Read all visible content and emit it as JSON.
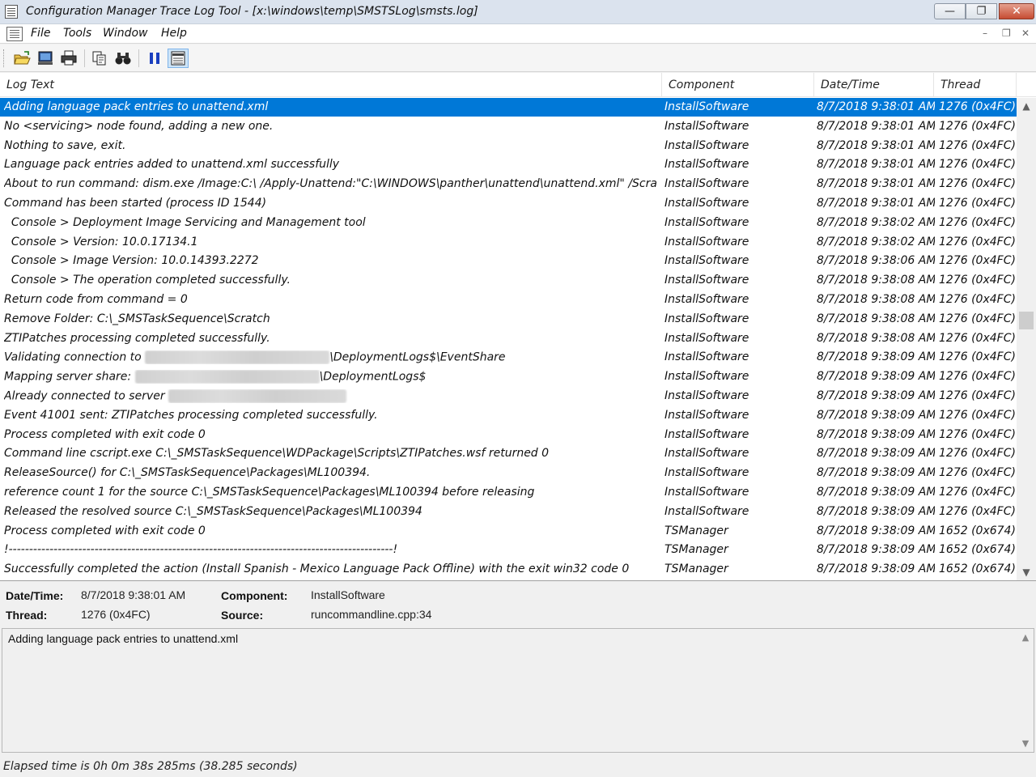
{
  "window": {
    "title": "Configuration Manager Trace Log Tool - [x:\\windows\\temp\\SMSTSLog\\smsts.log]",
    "minimize": "—",
    "maximize": "❐",
    "close": "✕"
  },
  "menu": {
    "items": [
      "File",
      "Tools",
      "Window",
      "Help"
    ],
    "mdi_min": "–",
    "mdi_restore": "❐",
    "mdi_close": "✕"
  },
  "toolbar": {
    "buttons": [
      "open-icon",
      "open-network-icon",
      "print-icon",
      "copy-icon",
      "find-icon",
      "pause-icon",
      "highlight-icon"
    ]
  },
  "columns": {
    "log_text": "Log Text",
    "component": "Component",
    "datetime": "Date/Time",
    "thread": "Thread"
  },
  "rows": [
    {
      "text": "Adding language pack entries to unattend.xml",
      "component": "InstallSoftware",
      "date": "8/7/2018 9:38:01 AM",
      "thread": "1276 (0x4FC)",
      "selected": true
    },
    {
      "text": "No <servicing> node found, adding a new one.",
      "component": "InstallSoftware",
      "date": "8/7/2018 9:38:01 AM",
      "thread": "1276 (0x4FC)"
    },
    {
      "text": "Nothing to save, exit.",
      "component": "InstallSoftware",
      "date": "8/7/2018 9:38:01 AM",
      "thread": "1276 (0x4FC)"
    },
    {
      "text": "Language pack entries added to unattend.xml successfully",
      "component": "InstallSoftware",
      "date": "8/7/2018 9:38:01 AM",
      "thread": "1276 (0x4FC)"
    },
    {
      "text": "About to run command: dism.exe /Image:C:\\ /Apply-Unattend:\"C:\\WINDOWS\\panther\\unattend\\unattend.xml\" /Scratch...",
      "component": "InstallSoftware",
      "date": "8/7/2018 9:38:01 AM",
      "thread": "1276 (0x4FC)"
    },
    {
      "text": "Command has been started (process ID 1544)",
      "component": "InstallSoftware",
      "date": "8/7/2018 9:38:01 AM",
      "thread": "1276 (0x4FC)"
    },
    {
      "text": "  Console > Deployment Image Servicing and Management tool",
      "component": "InstallSoftware",
      "date": "8/7/2018 9:38:02 AM",
      "thread": "1276 (0x4FC)"
    },
    {
      "text": "  Console > Version: 10.0.17134.1",
      "component": "InstallSoftware",
      "date": "8/7/2018 9:38:02 AM",
      "thread": "1276 (0x4FC)"
    },
    {
      "text": "  Console > Image Version: 10.0.14393.2272",
      "component": "InstallSoftware",
      "date": "8/7/2018 9:38:06 AM",
      "thread": "1276 (0x4FC)"
    },
    {
      "text": "  Console > The operation completed successfully.",
      "component": "InstallSoftware",
      "date": "8/7/2018 9:38:08 AM",
      "thread": "1276 (0x4FC)"
    },
    {
      "text": "Return code from command = 0",
      "component": "InstallSoftware",
      "date": "8/7/2018 9:38:08 AM",
      "thread": "1276 (0x4FC)"
    },
    {
      "text": "Remove Folder: C:\\_SMSTaskSequence\\Scratch",
      "component": "InstallSoftware",
      "date": "8/7/2018 9:38:08 AM",
      "thread": "1276 (0x4FC)"
    },
    {
      "text": "ZTIPatches processing completed successfully.",
      "component": "InstallSoftware",
      "date": "8/7/2018 9:38:08 AM",
      "thread": "1276 (0x4FC)"
    },
    {
      "text": "Validating connection to ",
      "text_after": "\\DeploymentLogs$\\EventShare",
      "blur": true,
      "component": "InstallSoftware",
      "date": "8/7/2018 9:38:09 AM",
      "thread": "1276 (0x4FC)"
    },
    {
      "text": "Mapping server share: ",
      "text_after": "\\DeploymentLogs$",
      "blur": true,
      "component": "InstallSoftware",
      "date": "8/7/2018 9:38:09 AM",
      "thread": "1276 (0x4FC)"
    },
    {
      "text": "Already connected to server ",
      "text_after": "",
      "blur": true,
      "component": "InstallSoftware",
      "date": "8/7/2018 9:38:09 AM",
      "thread": "1276 (0x4FC)"
    },
    {
      "text": "Event 41001 sent: ZTIPatches processing completed successfully.",
      "component": "InstallSoftware",
      "date": "8/7/2018 9:38:09 AM",
      "thread": "1276 (0x4FC)"
    },
    {
      "text": "Process completed with exit code 0",
      "component": "InstallSoftware",
      "date": "8/7/2018 9:38:09 AM",
      "thread": "1276 (0x4FC)"
    },
    {
      "text": "Command line cscript.exe C:\\_SMSTaskSequence\\WDPackage\\Scripts\\ZTIPatches.wsf returned 0",
      "component": "InstallSoftware",
      "date": "8/7/2018 9:38:09 AM",
      "thread": "1276 (0x4FC)"
    },
    {
      "text": "ReleaseSource() for C:\\_SMSTaskSequence\\Packages\\ML100394.",
      "component": "InstallSoftware",
      "date": "8/7/2018 9:38:09 AM",
      "thread": "1276 (0x4FC)"
    },
    {
      "text": "reference count 1 for the source C:\\_SMSTaskSequence\\Packages\\ML100394 before releasing",
      "component": "InstallSoftware",
      "date": "8/7/2018 9:38:09 AM",
      "thread": "1276 (0x4FC)"
    },
    {
      "text": "Released the resolved source C:\\_SMSTaskSequence\\Packages\\ML100394",
      "component": "InstallSoftware",
      "date": "8/7/2018 9:38:09 AM",
      "thread": "1276 (0x4FC)"
    },
    {
      "text": "Process completed with exit code 0",
      "component": "TSManager",
      "date": "8/7/2018 9:38:09 AM",
      "thread": "1652 (0x674)"
    },
    {
      "text": "!----------------------------------------------------------------------------------------------!",
      "component": "TSManager",
      "date": "8/7/2018 9:38:09 AM",
      "thread": "1652 (0x674)"
    },
    {
      "text": "Successfully completed the action (Install Spanish - Mexico Language Pack Offline) with the exit win32 code 0",
      "component": "TSManager",
      "date": "8/7/2018 9:38:09 AM",
      "thread": "1652 (0x674)"
    }
  ],
  "details": {
    "datetime_label": "Date/Time:",
    "datetime_value": "8/7/2018 9:38:01 AM",
    "component_label": "Component:",
    "component_value": "InstallSoftware",
    "thread_label": "Thread:",
    "thread_value": "1276 (0x4FC)",
    "source_label": "Source:",
    "source_value": "runcommandline.cpp:34"
  },
  "message": "Adding language pack entries to unattend.xml",
  "status": "Elapsed time is 0h 0m 38s 285ms (38.285 seconds)"
}
